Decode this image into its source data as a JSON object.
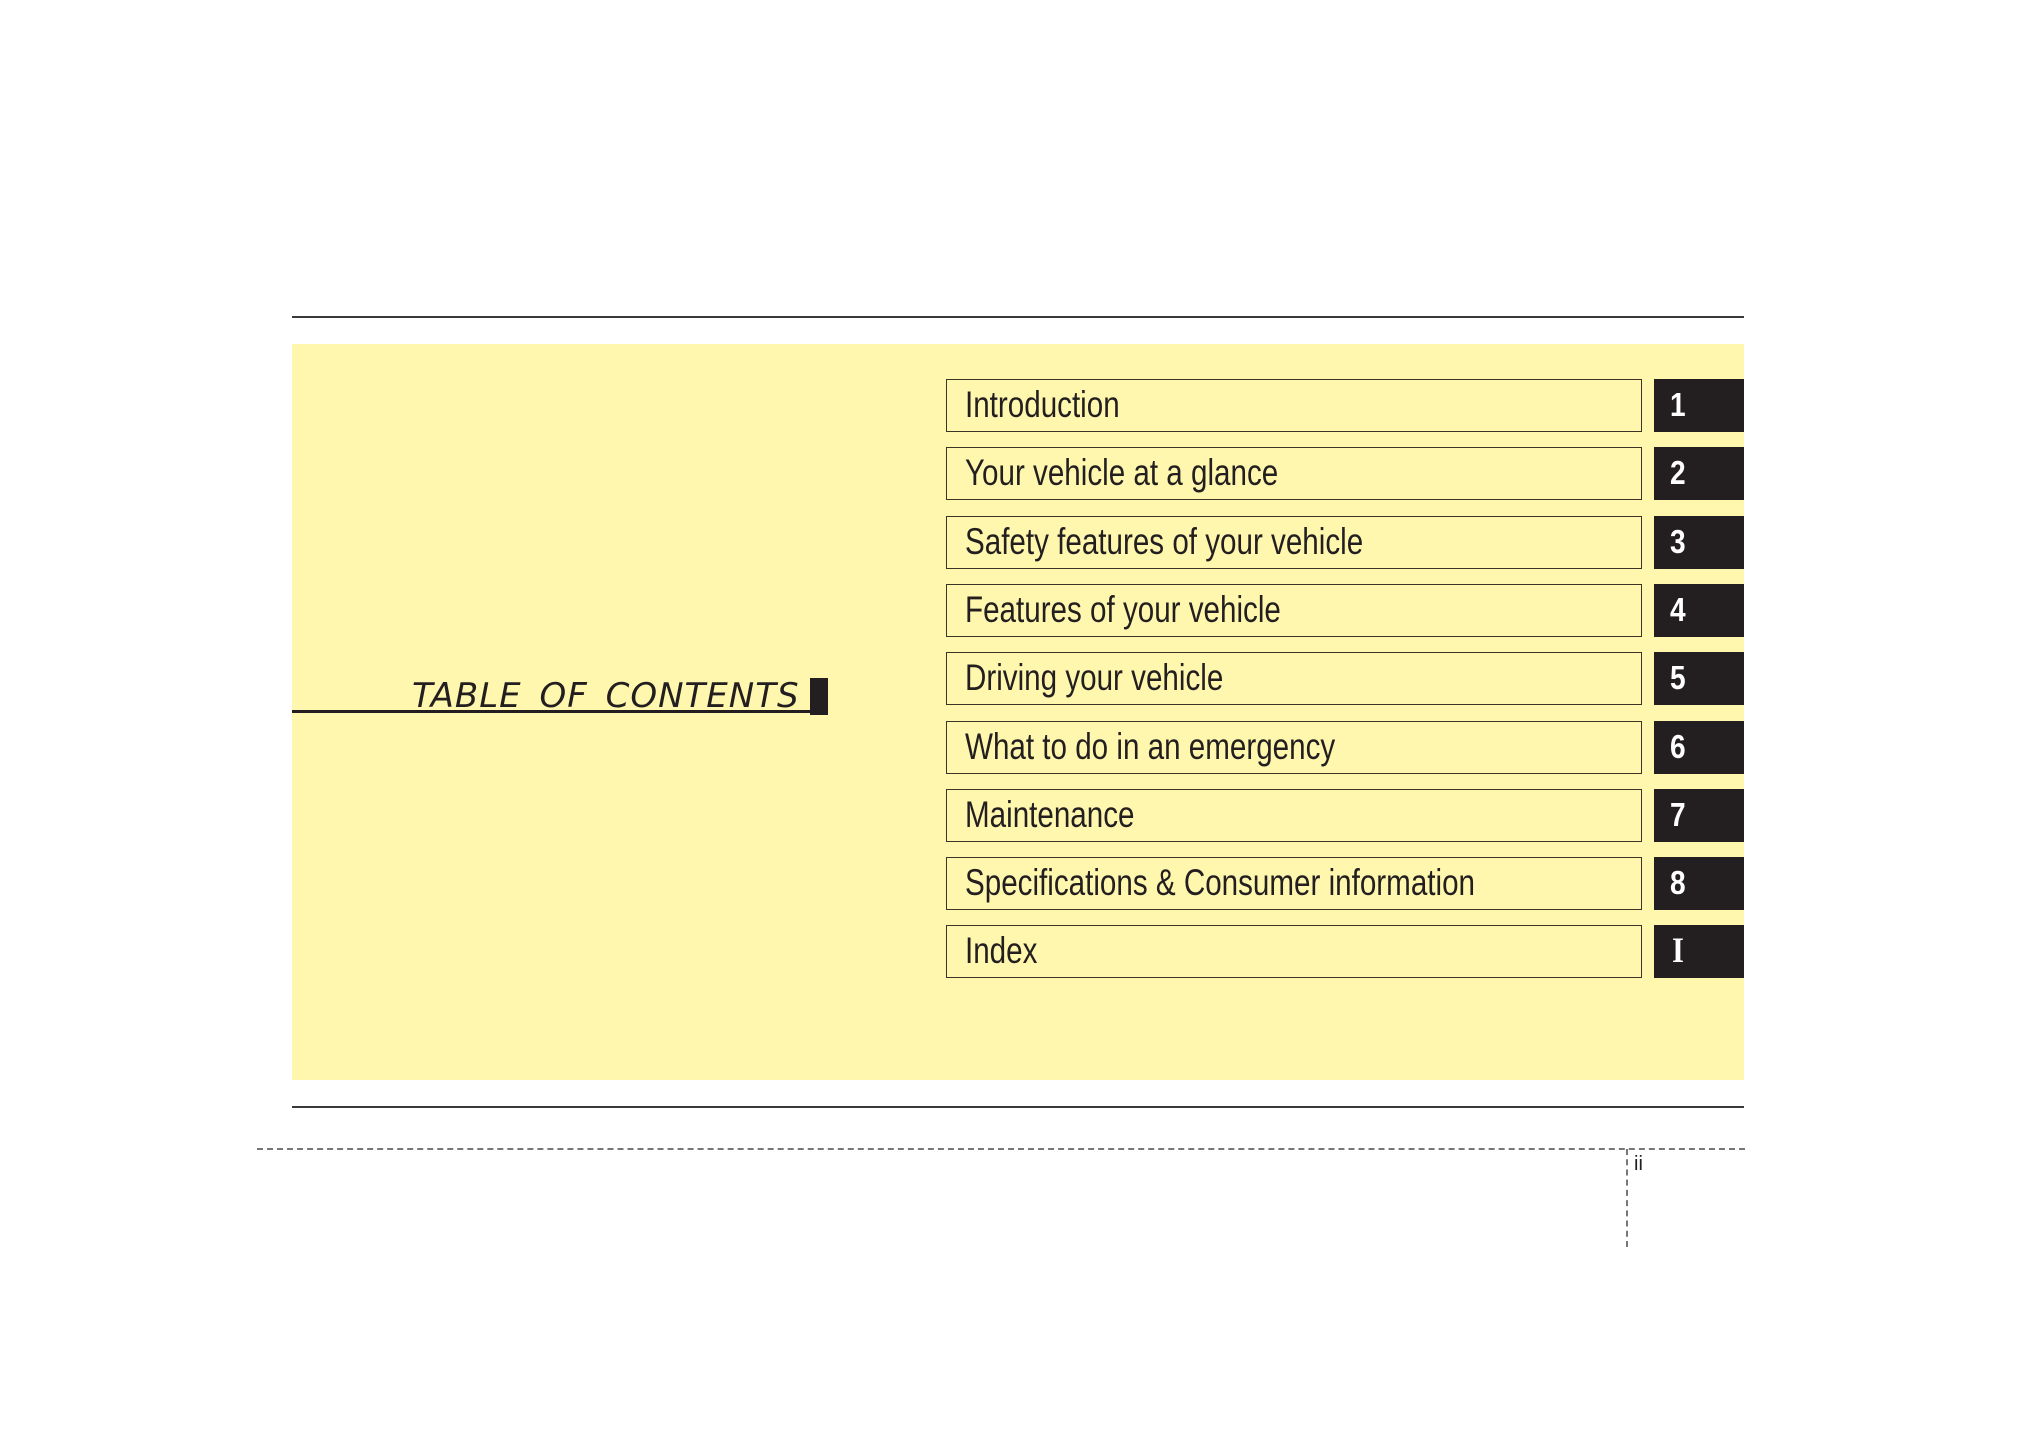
{
  "page": {
    "title": "TABLE OF CONTENTS",
    "page_number": "ii",
    "colors": {
      "panel_background": "#fff7ad",
      "ink": "#231f20",
      "tab_text": "#ffffff"
    }
  },
  "toc": {
    "entries": [
      {
        "label": "Introduction",
        "tab": "1"
      },
      {
        "label": "Your vehicle at a glance",
        "tab": "2"
      },
      {
        "label": "Safety features of your vehicle",
        "tab": "3"
      },
      {
        "label": "Features of your vehicle",
        "tab": "4"
      },
      {
        "label": "Driving your vehicle",
        "tab": "5"
      },
      {
        "label": "What to do in an emergency",
        "tab": "6"
      },
      {
        "label": "Maintenance",
        "tab": "7"
      },
      {
        "label": "Specifications & Consumer information",
        "tab": "8"
      },
      {
        "label": "Index",
        "tab": "I"
      }
    ]
  }
}
